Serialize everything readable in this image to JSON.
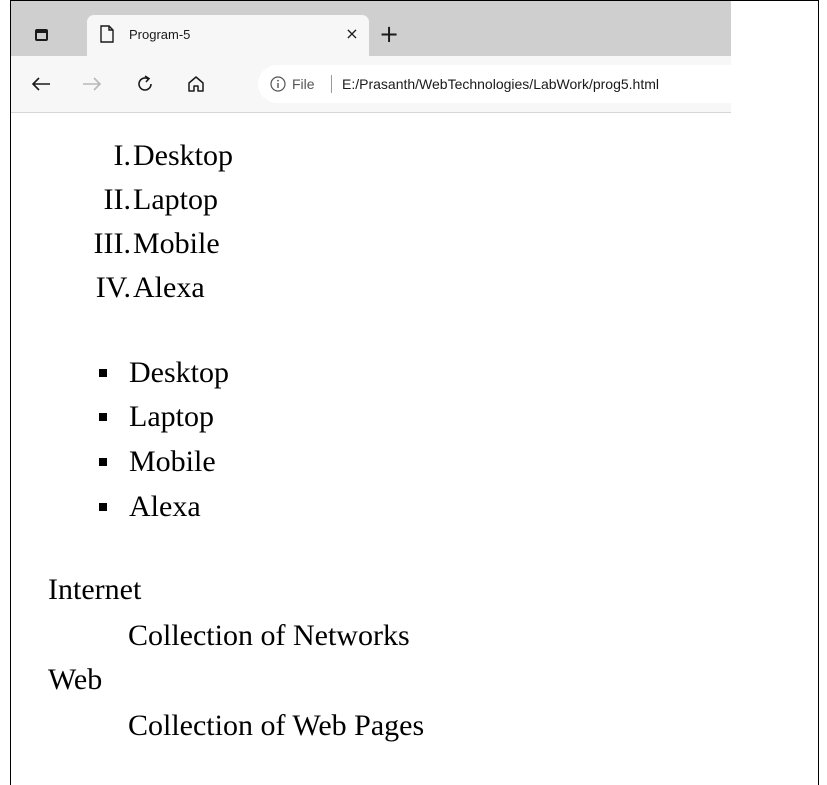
{
  "browser": {
    "tab_title": "Program-5",
    "tab_close": "×",
    "new_tab": "+",
    "address_scheme_label": "File",
    "address_url": "E:/Prasanth/WebTechnologies/LabWork/prog5.html"
  },
  "ordered_list": {
    "items": [
      {
        "marker": "I.",
        "text": "Desktop"
      },
      {
        "marker": "II.",
        "text": "Laptop"
      },
      {
        "marker": "III.",
        "text": "Mobile"
      },
      {
        "marker": "IV.",
        "text": "Alexa"
      }
    ]
  },
  "unordered_list": {
    "items": [
      "Desktop",
      "Laptop",
      "Mobile",
      "Alexa"
    ]
  },
  "definition_list": [
    {
      "term": "Internet",
      "description": "Collection of Networks"
    },
    {
      "term": "Web",
      "description": "Collection of Web Pages"
    }
  ],
  "icons": {
    "window_menu": "window-menu-icon",
    "tab_page": "page-icon",
    "back": "back-arrow-icon",
    "forward": "forward-arrow-icon",
    "refresh": "refresh-icon",
    "home": "home-icon",
    "info": "info-icon"
  }
}
